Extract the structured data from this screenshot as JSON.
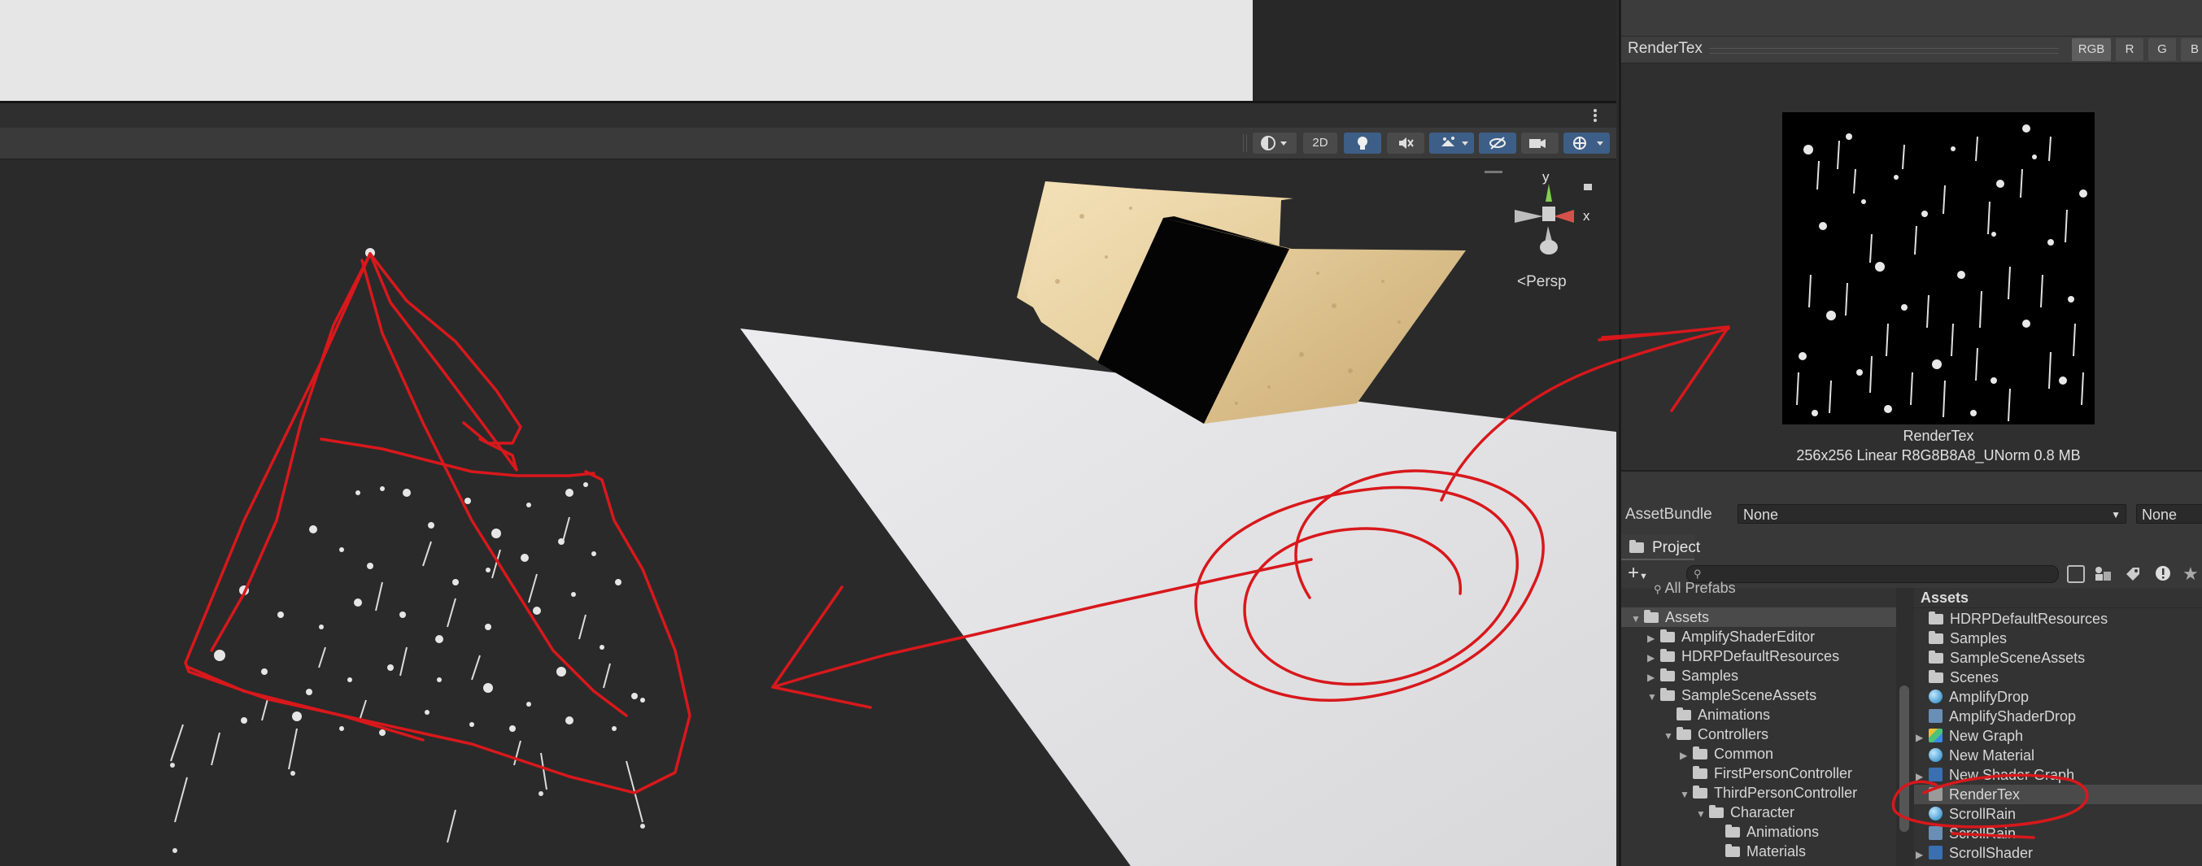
{
  "inspector": {
    "title": "RenderTex",
    "channels": [
      "RGB",
      "R",
      "G",
      "B"
    ],
    "texture_name": "RenderTex",
    "texture_info": "256x256 Linear  R8G8B8A8_UNorm  0.8 MB"
  },
  "asset_bundle": {
    "label": "AssetBundle",
    "name_value": "None",
    "variant_value": "None"
  },
  "scene": {
    "toolbar_2d": "2D",
    "persp_label": "<Persp",
    "gizmo_y": "y",
    "gizmo_x": "x"
  },
  "project": {
    "tab_label": "Project",
    "search_placeholder": "",
    "tree_partial": "All Prefabs",
    "tree": [
      {
        "label": "Assets",
        "depth": 0,
        "arrow": "▼",
        "selected": true
      },
      {
        "label": "AmplifyShaderEditor",
        "depth": 1,
        "arrow": "▶"
      },
      {
        "label": "HDRPDefaultResources",
        "depth": 1,
        "arrow": "▶"
      },
      {
        "label": "Samples",
        "depth": 1,
        "arrow": "▶"
      },
      {
        "label": "SampleSceneAssets",
        "depth": 1,
        "arrow": "▼"
      },
      {
        "label": "Animations",
        "depth": 2,
        "arrow": ""
      },
      {
        "label": "Controllers",
        "depth": 2,
        "arrow": "▼"
      },
      {
        "label": "Common",
        "depth": 3,
        "arrow": "▶"
      },
      {
        "label": "FirstPersonController",
        "depth": 3,
        "arrow": ""
      },
      {
        "label": "ThirdPersonController",
        "depth": 3,
        "arrow": "▼"
      },
      {
        "label": "Character",
        "depth": 4,
        "arrow": "▼"
      },
      {
        "label": "Animations",
        "depth": 5,
        "arrow": ""
      },
      {
        "label": "Materials",
        "depth": 5,
        "arrow": ""
      }
    ],
    "breadcrumb": "Assets",
    "assets": [
      {
        "label": "HDRPDefaultResources",
        "icon": "folder-icon",
        "arrow": ""
      },
      {
        "label": "Samples",
        "icon": "folder-icon",
        "arrow": ""
      },
      {
        "label": "SampleSceneAssets",
        "icon": "folder-icon",
        "arrow": ""
      },
      {
        "label": "Scenes",
        "icon": "folder-icon",
        "arrow": ""
      },
      {
        "label": "AmplifyDrop",
        "icon": "material-icon",
        "arrow": ""
      },
      {
        "label": "AmplifyShaderDrop",
        "icon": "shader-icon",
        "arrow": ""
      },
      {
        "label": "New Graph",
        "icon": "graph-icon",
        "arrow": "▶"
      },
      {
        "label": "New Material",
        "icon": "material-icon",
        "arrow": ""
      },
      {
        "label": "New Shader Graph",
        "icon": "shadergraph-icon",
        "arrow": "▶"
      },
      {
        "label": "RenderTex",
        "icon": "rendertexture-icon",
        "arrow": "",
        "selected": true
      },
      {
        "label": "ScrollRain",
        "icon": "material-icon",
        "arrow": ""
      },
      {
        "label": "ScrollRain",
        "icon": "shader-icon",
        "arrow": ""
      },
      {
        "label": "ScrollShader",
        "icon": "shadergraph-icon",
        "arrow": "▶"
      }
    ]
  },
  "colors": {
    "annotation_red": "#d8181c",
    "toolbar_active": "#3d5f87",
    "cube_sand": "#e8d2a4"
  }
}
